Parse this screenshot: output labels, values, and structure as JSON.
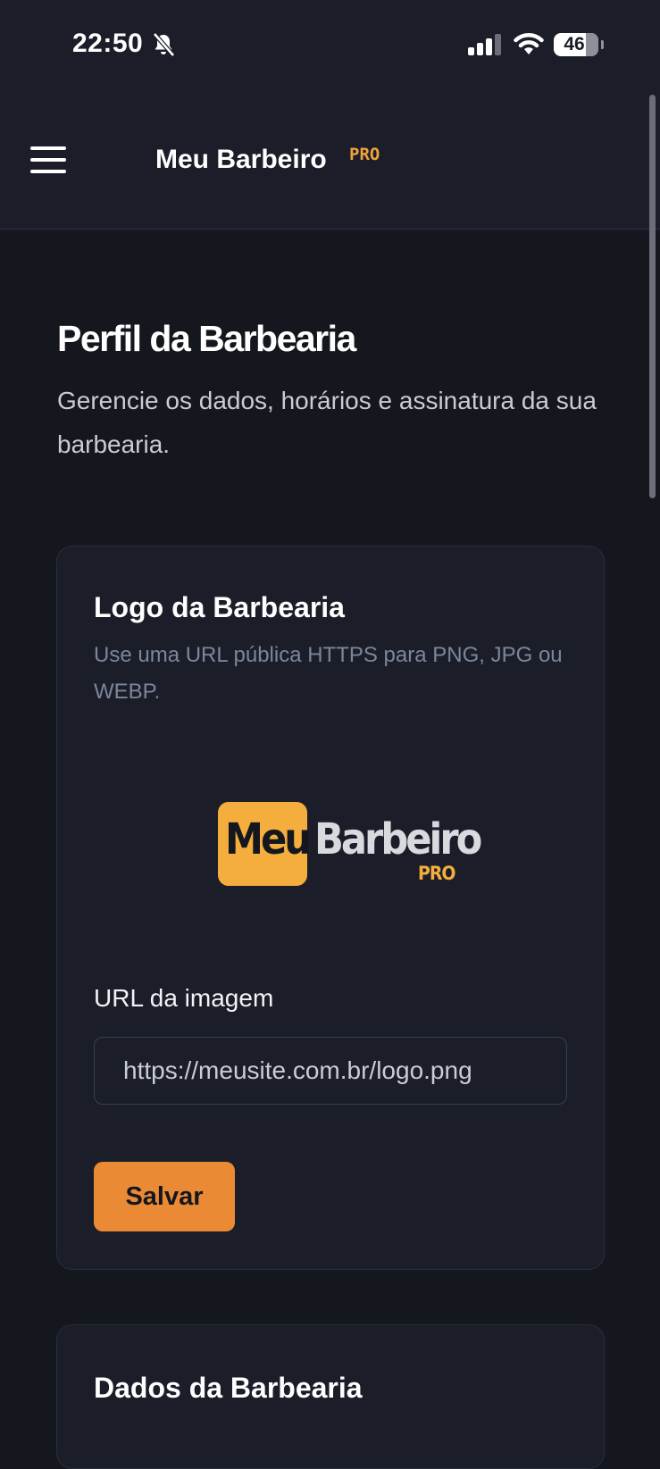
{
  "status_bar": {
    "time": "22:50",
    "battery": "46"
  },
  "header": {
    "app_title": "Meu Barbeiro",
    "app_badge": "PRO",
    "menu_icon": "hamburger-menu-icon"
  },
  "page": {
    "title": "Perfil da Barbearia",
    "subtitle": "Gerencie os dados, horários e assinatura da sua barbearia."
  },
  "logo_card": {
    "title": "Logo da Barbearia",
    "description": "Use uma URL pública HTTPS para PNG, JPG ou WEBP.",
    "logo": {
      "word1": "Meu",
      "word2": "Barbeiro",
      "badge": "PRO"
    },
    "url_label": "URL da imagem",
    "url_placeholder": "https://meusite.com.br/logo.png",
    "save_label": "Salvar"
  },
  "dados_card": {
    "title": "Dados da Barbearia"
  },
  "colors": {
    "background": "#15171f",
    "card": "#1b1e29",
    "accent": "#ea8a34",
    "logo_yellow": "#f4ae3d"
  }
}
